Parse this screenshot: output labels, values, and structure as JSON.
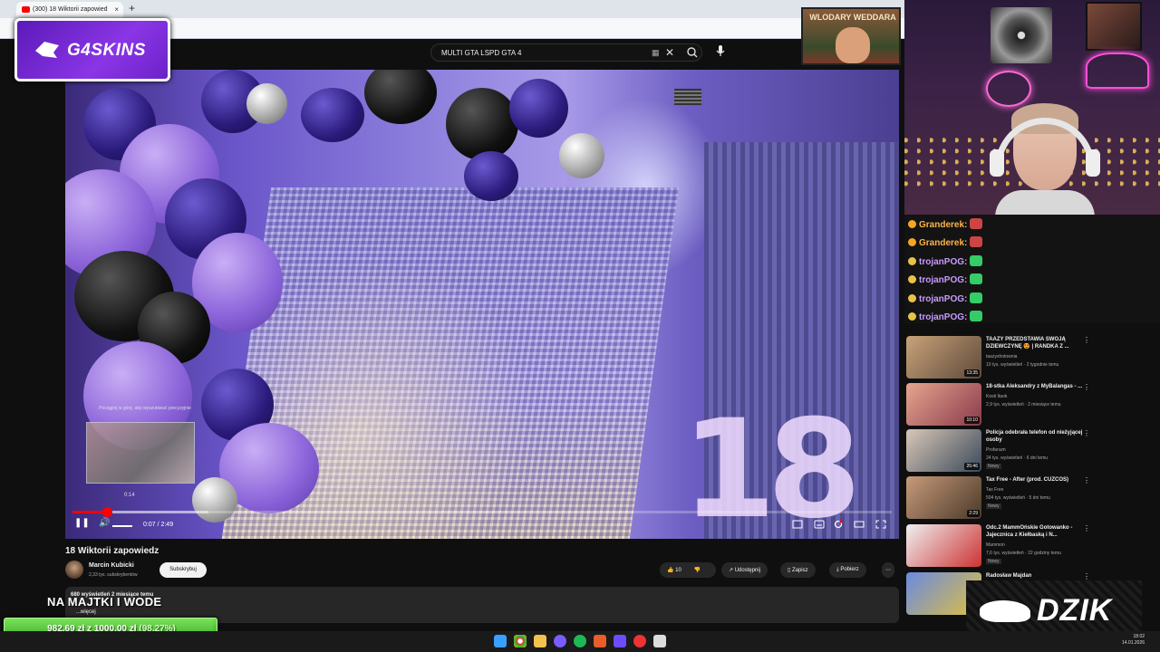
{
  "browser": {
    "tab_title": "(300) 18 Wiktorii zapowied",
    "new_tab": "+",
    "tab_close": "×"
  },
  "search": {
    "query": "MULTI GTA LSPD GTA 4"
  },
  "sponsor": {
    "g4_text": "G4SKINS",
    "wlodary_text": "WLODARY WEDDARA"
  },
  "video": {
    "preview_hint": "Pociągnij w górę, aby wyszukiwać precyzyjnie",
    "preview_time": "0:14",
    "timecode": "0:07 / 2:49",
    "progress_fraction": 0.042,
    "loaded_fraction": 0.166,
    "big_number": "18"
  },
  "info": {
    "title": "18 Wiktorii zapowiedz",
    "channel": "Marcin Kubicki",
    "subscribers": "2,33 tys. subskrybentów",
    "subscribe": "Subskrybuj",
    "likes": "10",
    "share": "Udostępnij",
    "save": "Zapisz",
    "download": "Pobierz",
    "more": "⋯",
    "views_meta": "680 wyświetleń  2 miesiące temu",
    "more_link": "...więcej"
  },
  "overlays": {
    "najmajtki": "NA MAJTKI I WODE",
    "goal_amount": "982,69 zł",
    "goal_sep": "z",
    "goal_target": "1000,00 zł",
    "goal_pct": "(98.27%)",
    "goal_fraction": 0.9827,
    "dzik": "DZIK"
  },
  "chat": [
    {
      "user": "Granderek:",
      "color": "#ffb347"
    },
    {
      "user": "Granderek:",
      "color": "#ffb347"
    },
    {
      "user": "trojanPOG:",
      "color": "#c89bff"
    },
    {
      "user": "trojanPOG:",
      "color": "#c89bff"
    },
    {
      "user": "trojanPOG:",
      "color": "#c89bff"
    },
    {
      "user": "trojanPOG:",
      "color": "#c89bff"
    }
  ],
  "recs": [
    {
      "title": "TAAZY PRZEDSTAWIA SWOJĄ DZIEWCZYNĘ 😍 | RANDKA Z ...",
      "channel": "taazyshotownia",
      "meta": "10 tys. wyświetleń · 2 tygodnie temu",
      "duration": "13:35",
      "new": ""
    },
    {
      "title": "18-stka Aleksandry z MyBalangas - ...",
      "channel": "Kosti Itaok",
      "meta": "2,9 tys. wyświetleń · 2 miesiące temu",
      "duration": "10:10",
      "new": ""
    },
    {
      "title": "Policja odebrała telefon od nieżyjącej osoby",
      "channel": "Profanum",
      "meta": "24 tys. wyświetleń · 6 dni temu",
      "duration": "26:46",
      "new": "Nowy"
    },
    {
      "title": "Tax Free - After (prod. CUZCOS)",
      "channel": "Tax Free",
      "meta": "504 tys. wyświetleń · 5 dni temu",
      "duration": "2:29",
      "new": "Nowy"
    },
    {
      "title": "Odc.2 MammOńskie Gotowanko - Jajecznica z Kiełbaską i N...",
      "channel": "Mammon",
      "meta": "7,6 tys. wyświetleń · 22 godziny temu",
      "duration": "",
      "new": "Nowy"
    },
    {
      "title": "Radosław Majdan",
      "channel": "",
      "meta": "",
      "duration": "",
      "new": ""
    }
  ],
  "taskbar": {
    "time": "18:02",
    "date": "14.01.2026"
  },
  "colors": {
    "accent_red": "#ff0000",
    "goal_green": "#2ea21a",
    "g4_purple": "#7a2ad8"
  }
}
